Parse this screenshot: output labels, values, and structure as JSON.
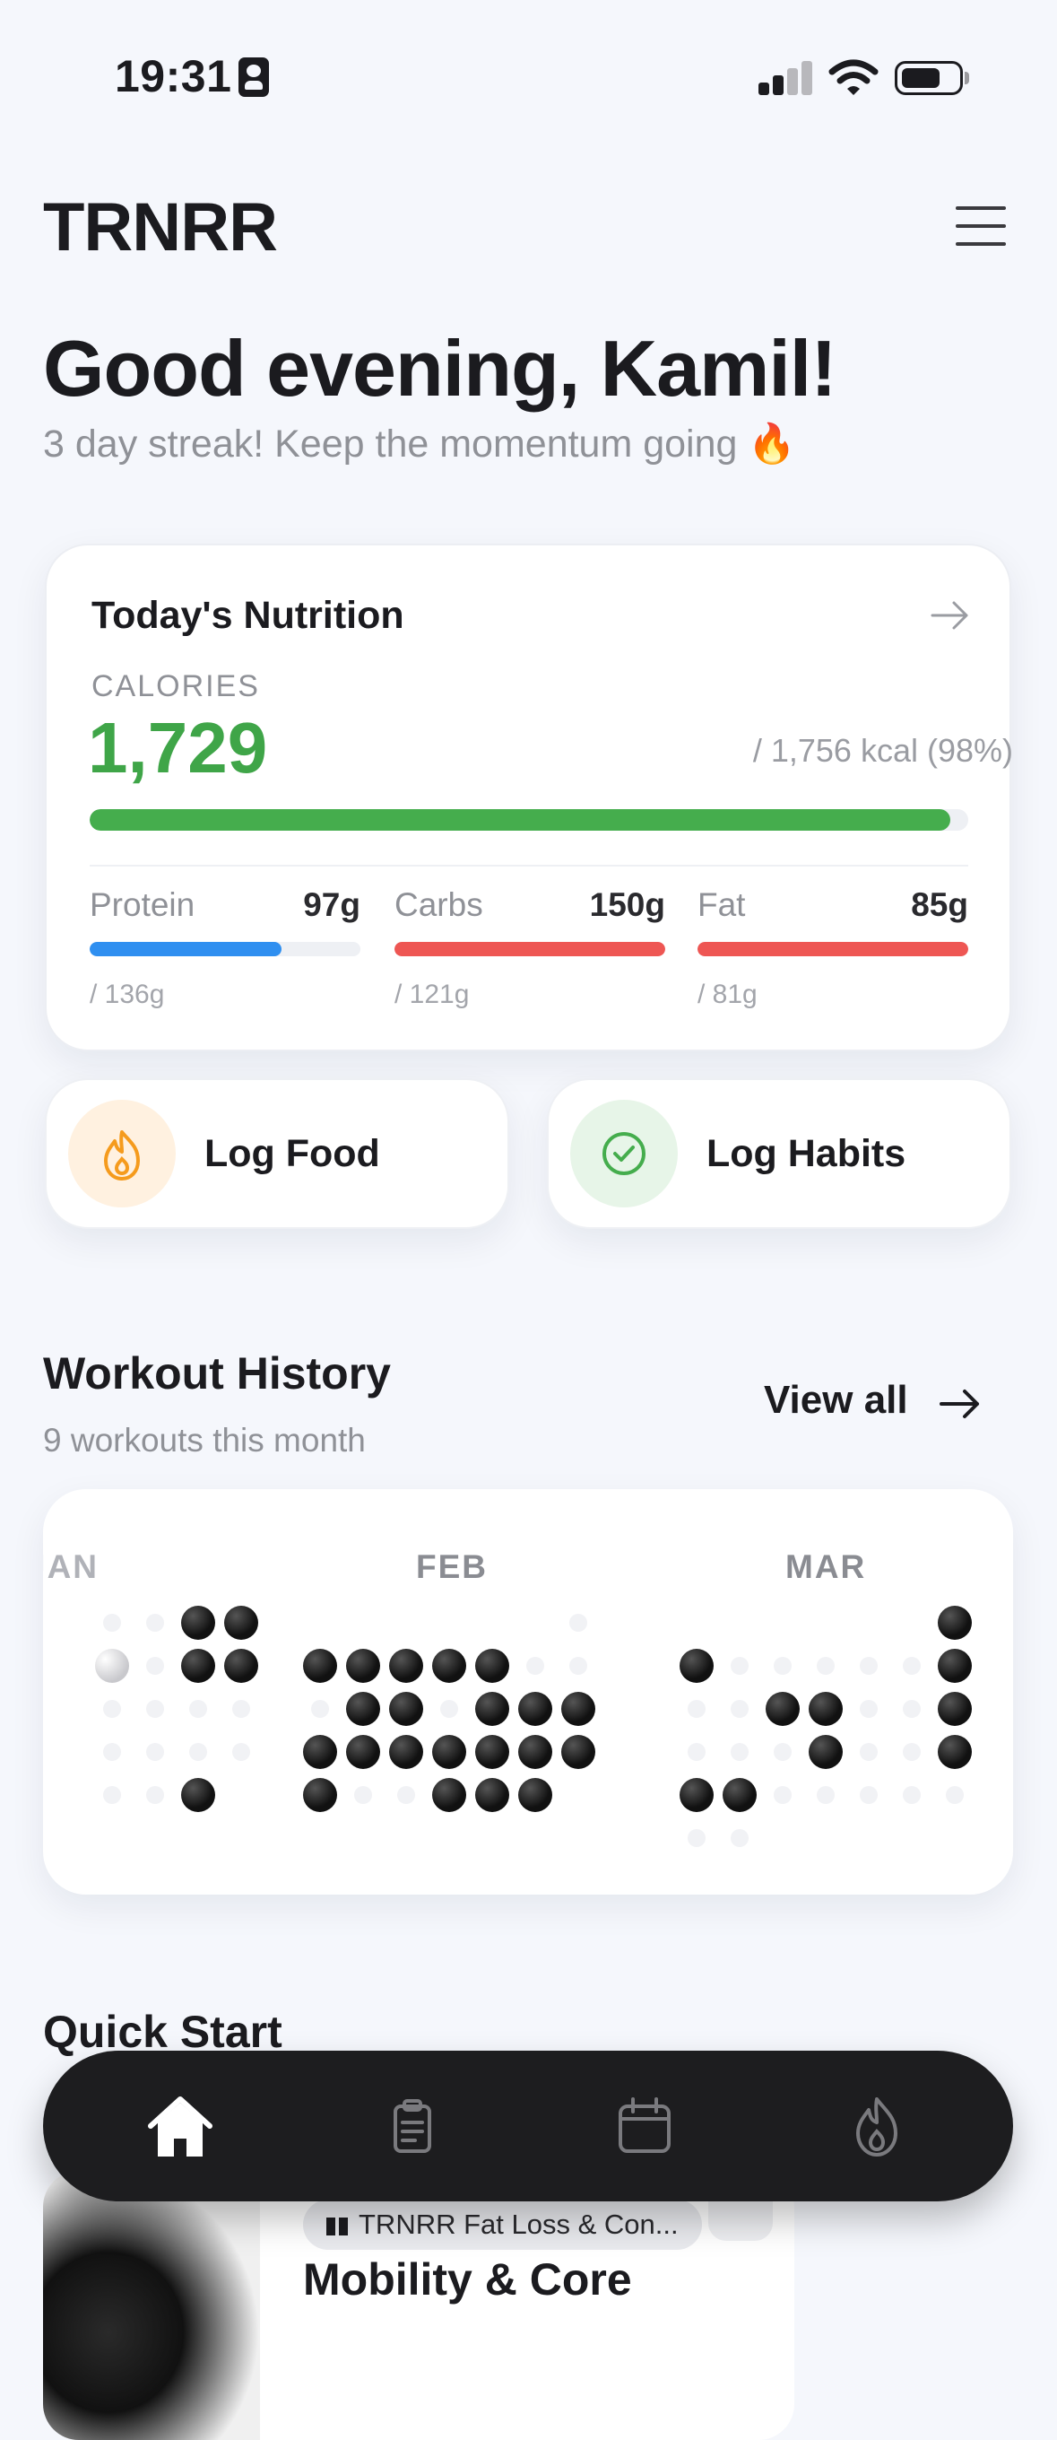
{
  "status_bar": {
    "time": "19:31"
  },
  "header": {
    "logo": "TRNRR"
  },
  "greeting": {
    "title": "Good evening, Kamil!",
    "subtitle": "3 day streak! Keep the momentum going 🔥"
  },
  "nutrition": {
    "title": "Today's Nutrition",
    "calories_label": "CALORIES",
    "calories_value": "1,729",
    "calories_goal": "/ 1,756 kcal (98%)",
    "calories_progress": 0.98,
    "macros": [
      {
        "name": "Protein",
        "value": "97g",
        "goal": "/ 136g",
        "progress": 0.71,
        "color": "#2f8ff0"
      },
      {
        "name": "Carbs",
        "value": "150g",
        "goal": "/ 121g",
        "progress": 1.0,
        "color": "#ee5653"
      },
      {
        "name": "Fat",
        "value": "85g",
        "goal": "/ 81g",
        "progress": 1.0,
        "color": "#ee5653"
      }
    ],
    "accent_color": "#45ad4d"
  },
  "actions": {
    "log_food": {
      "label": "Log Food",
      "icon": "flame-icon",
      "icon_bg": "#fff1e0",
      "icon_color": "#f59b1d"
    },
    "log_habits": {
      "label": "Log Habits",
      "icon": "check-circle-icon",
      "icon_bg": "#e7f5e8",
      "icon_color": "#45ad4d"
    }
  },
  "workout_history": {
    "title": "Workout History",
    "subtitle": "9 workouts this month",
    "view_all": "View all",
    "months": [
      "JAN",
      "FEB",
      "MAR"
    ]
  },
  "quick_start": {
    "title": "Quick Start",
    "program_tag": "TRNRR Fat Loss & Con...",
    "workout_name": "Mobility & Core"
  },
  "bottom_nav": {
    "items": [
      "home-icon",
      "clipboard-icon",
      "calendar-icon",
      "flame-icon"
    ],
    "active": "home-icon"
  }
}
